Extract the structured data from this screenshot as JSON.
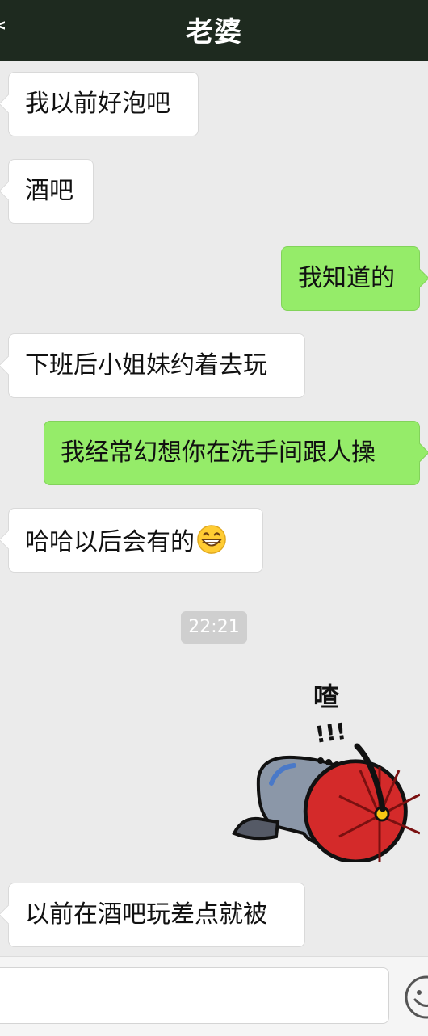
{
  "header": {
    "title": "老婆",
    "back_glyph": "<"
  },
  "messages": [
    {
      "side": "left",
      "text": "我以前好泡吧"
    },
    {
      "side": "left",
      "text": "酒吧"
    },
    {
      "side": "right",
      "text": "我知道的"
    },
    {
      "side": "left",
      "text": "下班后小姐妹约着去玩"
    },
    {
      "side": "right",
      "text": "我经常幻想你在洗手间跟人操"
    },
    {
      "side": "left",
      "text": "哈哈以后会有的",
      "emoji": "grinning-face-icon"
    },
    {
      "side": "left",
      "text": "以前在酒吧玩差点就被"
    }
  ],
  "timestamp": "22:21",
  "sticker": {
    "caption": "喳",
    "exclamation": "!!!",
    "icon": "kowtowing-servant-sticker"
  },
  "input": {
    "value": "",
    "emoji_button_icon": "smiley-face-icon"
  },
  "colors": {
    "header_bg": "#1e2a1f",
    "background": "#ebebeb",
    "incoming_bubble": "#ffffff",
    "outgoing_bubble": "#95ec69",
    "timestamp_bg": "#cfcfcf"
  }
}
